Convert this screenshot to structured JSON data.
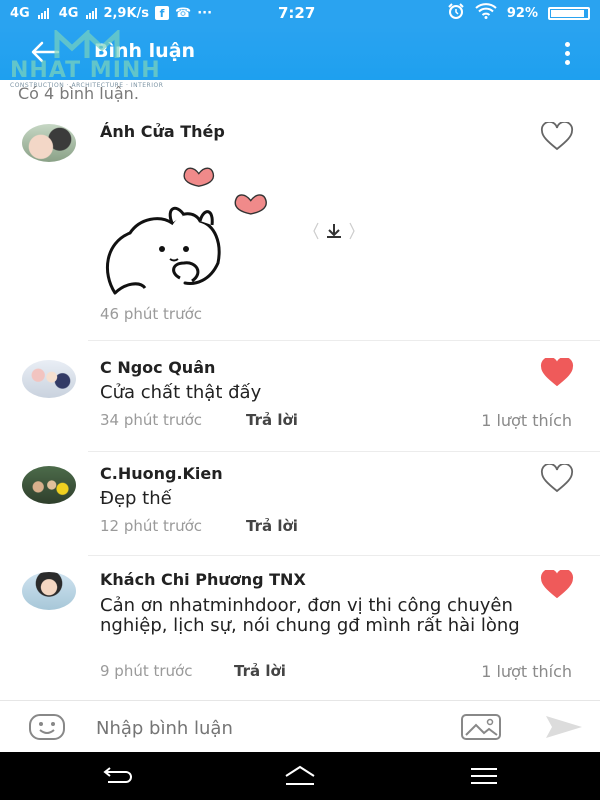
{
  "status_bar": {
    "network1": "4G",
    "network2": "4G",
    "speed": "2,9K/s",
    "dots": "···",
    "time": "7:27",
    "battery": "92%"
  },
  "header": {
    "title": "Bình luận"
  },
  "watermark": {
    "name": "NHAT MINH",
    "tagline": "CONSTRUCTION · ARCHITECTURE · INTERIOR"
  },
  "comments_count": "Có 4 bình luận.",
  "comments": [
    {
      "author": "Ánh Cửa Thép",
      "text": "",
      "time": "46 phút trước",
      "reply": "",
      "likes": "",
      "liked": false
    },
    {
      "author": "C Ngoc Quân",
      "text": "Cửa chất thật đấy",
      "time": "34 phút trước",
      "reply": "Trả lời",
      "likes": "1 lượt thích",
      "liked": true
    },
    {
      "author": "C.Huong.Kien",
      "text": "Đẹp thế",
      "time": "12 phút trước",
      "reply": "Trả lời",
      "likes": "",
      "liked": false
    },
    {
      "author": "Khách Chi Phương TNX",
      "text": "Cản ơn nhatminhdoor, đơn vị thi công chuyên nghiệp, lịch sự, nói chung gđ mình rất hài lòng",
      "time": "9 phút trước",
      "reply": "Trả lời",
      "likes": "1 lượt thích",
      "liked": true
    }
  ],
  "input": {
    "placeholder": "Nhập bình luận"
  },
  "colors": {
    "header": "#2aa3f0",
    "heart_liked": "#ef5a5a",
    "heart_outline": "#666666"
  }
}
